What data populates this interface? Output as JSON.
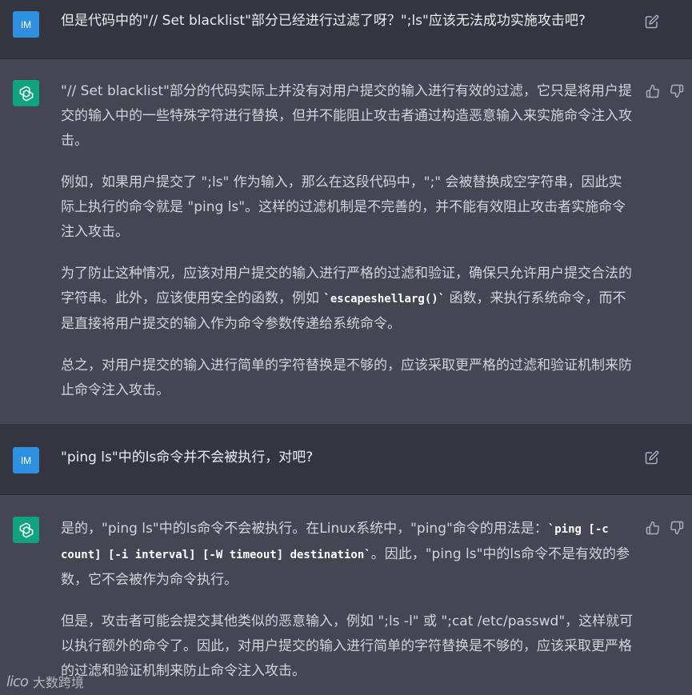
{
  "colors": {
    "user_bg": "#343541",
    "assistant_bg": "#444654",
    "user_avatar": "#2f8fe0",
    "assistant_avatar": "#10a37f",
    "text": "#d1d5db"
  },
  "turns": [
    {
      "role": "user",
      "avatar_label": "IM",
      "text": "但是代码中的\"// Set blacklist\"部分已经进行过滤了呀？\";ls\"应该无法成功实施攻击吧?"
    },
    {
      "role": "assistant",
      "paragraphs": [
        "\"// Set blacklist\"部分的代码实际上并没有对用户提交的输入进行有效的过滤，它只是将用户提交的输入中的一些特殊字符进行替换，但并不能阻止攻击者通过构造恶意输入来实施命令注入攻击。",
        "例如，如果用户提交了 \";ls\" 作为输入，那么在这段代码中，\";\" 会被替换成空字符串，因此实际上执行的命令就是 \"ping ls\"。这样的过滤机制是不完善的，并不能有效阻止攻击者实施命令注入攻击。",
        {
          "before": "为了防止这种情况，应该对用户提交的输入进行严格的过滤和验证，确保只允许用户提交合法的字符串。此外，应该使用安全的函数，例如 ",
          "code": "`escapeshellarg()`",
          "after": " 函数，来执行系统命令，而不是直接将用户提交的输入作为命令参数传递给系统命令。"
        },
        "总之，对用户提交的输入进行简单的字符替换是不够的，应该采取更严格的过滤和验证机制来防止命令注入攻击。"
      ]
    },
    {
      "role": "user",
      "avatar_label": "IM",
      "text": "\"ping ls\"中的ls命令并不会被执行，对吧?"
    },
    {
      "role": "assistant",
      "paragraphs": [
        {
          "before": "是的，\"ping ls\"中的ls命令不会被执行。在Linux系统中，\"ping\"命令的用法是：",
          "code": "`ping [-c count] [-i interval] [-W timeout] destination`",
          "after": "。因此，\"ping ls\"中的ls命令不是有效的参数，它不会被作为命令执行。"
        },
        "但是，攻击者可能会提交其他类似的恶意输入，例如 \";ls -l\" 或 \";cat /etc/passwd\"，这样就可以执行额外的命令了。因此，对用户提交的输入进行简单的字符替换是不够的，应该采取更严格的过滤和验证机制来防止命令注入攻击。"
      ]
    }
  ],
  "icons": {
    "edit": "edit-icon",
    "thumbs_up": "thumbs-up-icon",
    "thumbs_down": "thumbs-down-icon",
    "openai_logo": "openai-logo-icon"
  },
  "watermark": {
    "logo_text": "lico",
    "label": "大数跨境"
  }
}
